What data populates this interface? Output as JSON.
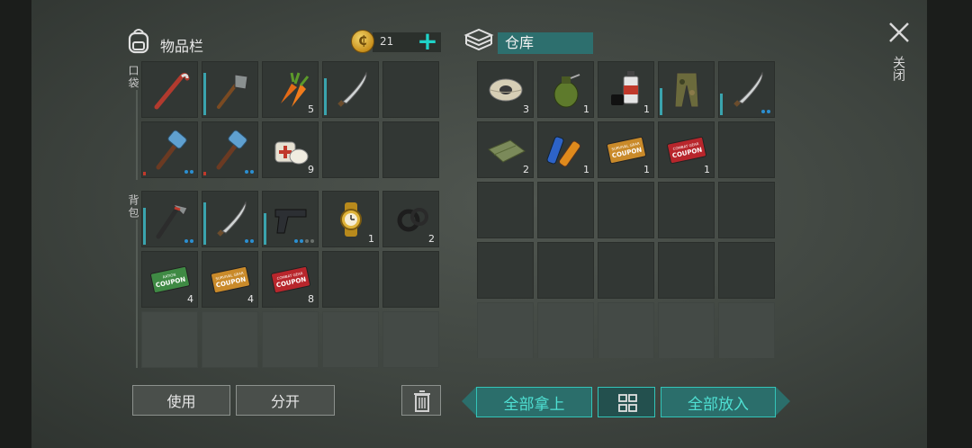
{
  "header": {
    "inventory_title": "物品栏",
    "coin_symbol": "₵",
    "coin_count": "21",
    "plus_label": "+",
    "storage_title": "仓库",
    "close_label": "关闭"
  },
  "sections": {
    "pocket_label": "口袋",
    "backpack_label": "背包"
  },
  "pocket": [
    {
      "icon": "crowbar-icon",
      "count": "",
      "durability": 0
    },
    {
      "icon": "shovel-icon",
      "count": "",
      "durability": 0.8
    },
    {
      "icon": "carrot-icon",
      "count": "5",
      "durability": 0
    },
    {
      "icon": "machete-icon",
      "count": "",
      "durability": 0.7
    },
    {
      "icon": "",
      "count": "",
      "durability": 0
    },
    {
      "icon": "sledgehammer-icon",
      "count": "",
      "durability": 0.1,
      "dots": 2
    },
    {
      "icon": "sledgehammer-icon",
      "count": "",
      "durability": 0.1,
      "dots": 2
    },
    {
      "icon": "bandage-icon",
      "count": "9",
      "durability": 0
    },
    {
      "icon": "",
      "count": "",
      "durability": 0
    },
    {
      "icon": "",
      "count": "",
      "durability": 0
    }
  ],
  "backpack": [
    {
      "icon": "hammer-icon",
      "count": "",
      "durability": 0.7,
      "dots": 2
    },
    {
      "icon": "machete-icon",
      "count": "",
      "durability": 0.8,
      "dots": 2
    },
    {
      "icon": "pistol-icon",
      "count": "",
      "durability": 0.6,
      "dots": 4
    },
    {
      "icon": "watch-icon",
      "count": "1",
      "durability": 0
    },
    {
      "icon": "tape-icon",
      "count": "2",
      "durability": 0
    },
    {
      "icon": "ration-coupon-icon",
      "count": "4",
      "durability": 0
    },
    {
      "icon": "survival-coupon-icon",
      "count": "4",
      "durability": 0
    },
    {
      "icon": "combat-coupon-icon",
      "count": "8",
      "durability": 0
    }
  ],
  "storage": [
    {
      "icon": "wire-spool-icon",
      "count": "3",
      "durability": 0
    },
    {
      "icon": "grenade-icon",
      "count": "1",
      "durability": 0
    },
    {
      "icon": "spray-can-icon",
      "count": "1",
      "durability": 0
    },
    {
      "icon": "camo-pants-icon",
      "count": "",
      "durability": 0.5
    },
    {
      "icon": "machete-icon",
      "count": "",
      "durability": 0.4,
      "dots": 2
    },
    {
      "icon": "cloth-icon",
      "count": "2",
      "durability": 0
    },
    {
      "icon": "batteries-icon",
      "count": "1",
      "durability": 0
    },
    {
      "icon": "survival-coupon-icon",
      "count": "1",
      "durability": 0
    },
    {
      "icon": "combat-coupon-icon",
      "count": "1",
      "durability": 0
    }
  ],
  "coupons": {
    "ration_top": "RATION",
    "survival_top": "SURVIVAL GEAR",
    "combat_top": "COMBAT GEAR",
    "word": "COUPON"
  },
  "buttons": {
    "use": "使用",
    "split": "分开",
    "take_all": "全部拿上",
    "put_all": "全部放入"
  },
  "colors": {
    "accent_teal": "#33c4b8",
    "button_teal": "#2b6e6b",
    "durability_blue": "#3aa4ae",
    "durability_red": "#c0392b",
    "coin_gold": "#d9a42a"
  }
}
